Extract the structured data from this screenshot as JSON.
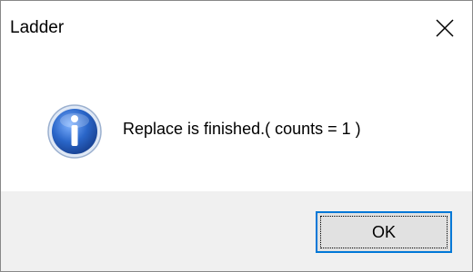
{
  "window": {
    "title": "Ladder",
    "close_icon": "close-icon"
  },
  "message": {
    "icon": "info-icon",
    "text": "Replace is finished.( counts = 1 )"
  },
  "buttons": {
    "ok_label": "OK"
  },
  "colors": {
    "focus_border": "#0078d7",
    "footer_bg": "#f0f0f0",
    "button_bg": "#e1e1e1",
    "icon_blue": "#1f5fb8"
  }
}
